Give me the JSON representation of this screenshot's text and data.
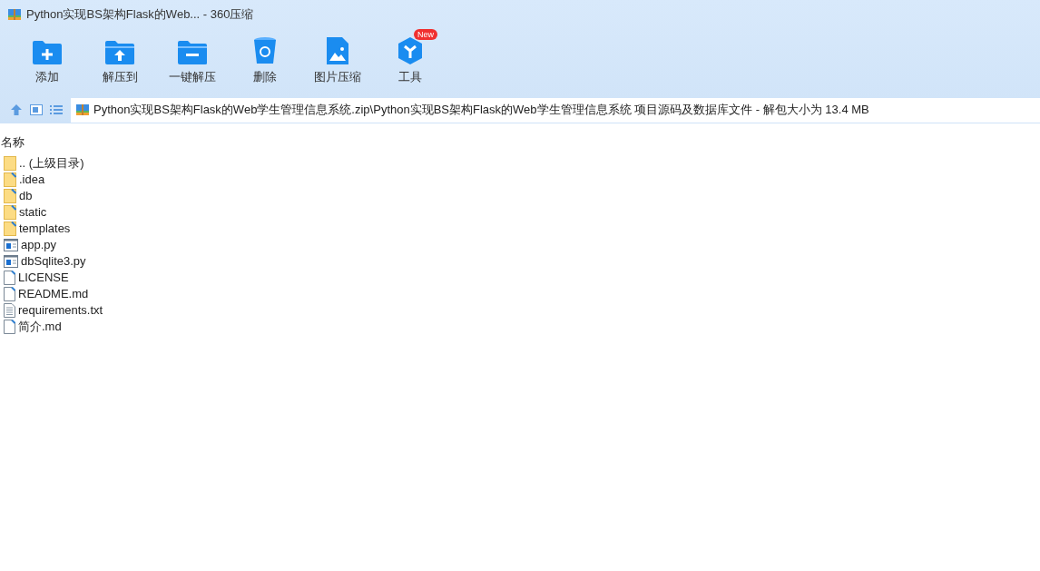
{
  "window": {
    "title": "Python实现BS架构Flask的Web... - 360压缩"
  },
  "toolbar": [
    {
      "kind": "add",
      "label": "添加"
    },
    {
      "kind": "extract",
      "label": "解压到"
    },
    {
      "kind": "oneclick",
      "label": "一键解压"
    },
    {
      "kind": "delete",
      "label": "删除"
    },
    {
      "kind": "image",
      "label": "图片压缩"
    },
    {
      "kind": "tools",
      "label": "工具",
      "badge": "New"
    }
  ],
  "address": {
    "path": "Python实现BS架构Flask的Web学生管理信息系统.zip\\Python实现BS架构Flask的Web学生管理信息系统 项目源码及数据库文件 - 解包大小为 13.4 MB"
  },
  "table": {
    "columns": [
      "名称"
    ],
    "rows": [
      {
        "kind": "parent",
        "name": ".. (上级目录)"
      },
      {
        "kind": "folder",
        "name": ".idea"
      },
      {
        "kind": "folder",
        "name": "db"
      },
      {
        "kind": "folder",
        "name": "static"
      },
      {
        "kind": "folder",
        "name": "templates"
      },
      {
        "kind": "python",
        "name": "app.py"
      },
      {
        "kind": "python",
        "name": "dbSqlite3.py"
      },
      {
        "kind": "file",
        "name": "LICENSE"
      },
      {
        "kind": "file",
        "name": "README.md"
      },
      {
        "kind": "text",
        "name": "requirements.txt"
      },
      {
        "kind": "file",
        "name": "简介.md"
      }
    ]
  }
}
